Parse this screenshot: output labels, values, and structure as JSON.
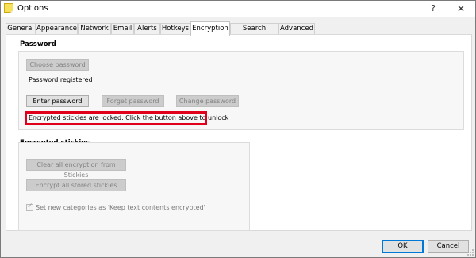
{
  "window": {
    "title": "Options",
    "help_glyph": "?",
    "close_glyph": "✕"
  },
  "tabs": [
    {
      "label": "General"
    },
    {
      "label": "Appearance"
    },
    {
      "label": "Network"
    },
    {
      "label": "Email"
    },
    {
      "label": "Alerts"
    },
    {
      "label": "Hotkeys"
    },
    {
      "label": "Encryption",
      "active": true
    },
    {
      "label": "Search Engines"
    },
    {
      "label": "Advanced"
    }
  ],
  "password_group": {
    "title": "Password",
    "choose_password": "Choose password",
    "status": "Password registered",
    "enter_password": "Enter password",
    "forget_password": "Forget password",
    "change_password": "Change password",
    "locked_message": "Encrypted stickies are locked.  Click the button above to unlock"
  },
  "encrypted_group": {
    "title": "Encrypted stickies",
    "clear_all": "Clear all encryption from Stickies",
    "encrypt_all": "Encrypt all stored stickies",
    "checkbox_label": "Set new categories as 'Keep text contents encrypted'",
    "checkbox_checked": true
  },
  "footer": {
    "ok": "OK",
    "cancel": "Cancel"
  },
  "colors": {
    "highlight": "#e0001b",
    "default_button": "#0078d7"
  }
}
